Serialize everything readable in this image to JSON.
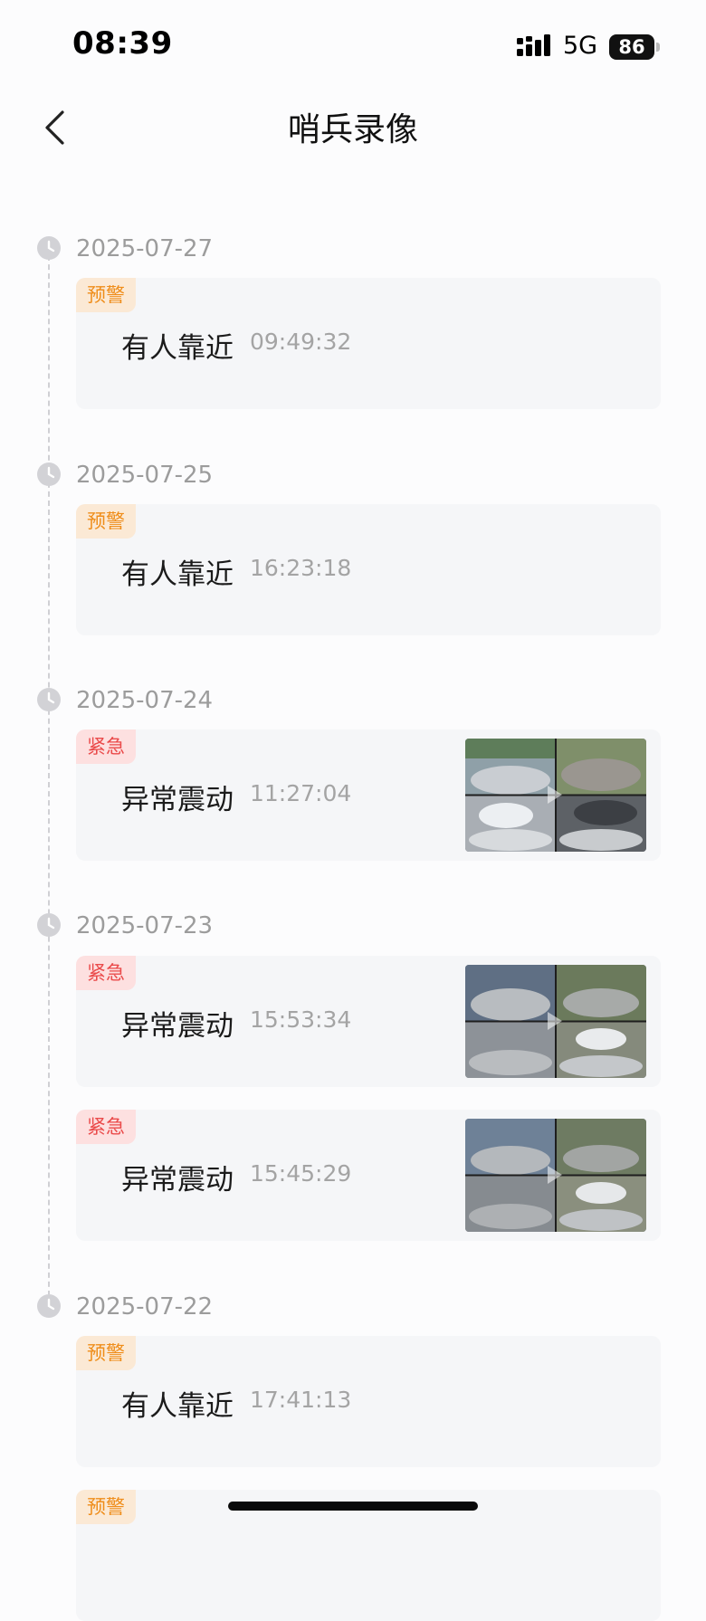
{
  "status_bar": {
    "time": "08:39",
    "network": "5G",
    "battery": "86"
  },
  "header": {
    "title": "哨兵录像",
    "back_icon": "chevron-left-icon"
  },
  "timeline": [
    {
      "date": "2025-07-27",
      "records": [
        {
          "badge": "预警",
          "badge_type": "warn",
          "event": "有人靠近",
          "time": "09:49:32",
          "has_thumbnail": false
        }
      ]
    },
    {
      "date": "2025-07-25",
      "records": [
        {
          "badge": "预警",
          "badge_type": "warn",
          "event": "有人靠近",
          "time": "16:23:18",
          "has_thumbnail": false
        }
      ]
    },
    {
      "date": "2025-07-24",
      "records": [
        {
          "badge": "紧急",
          "badge_type": "urgent",
          "event": "异常震动",
          "time": "11:27:04",
          "has_thumbnail": true
        }
      ]
    },
    {
      "date": "2025-07-23",
      "records": [
        {
          "badge": "紧急",
          "badge_type": "urgent",
          "event": "异常震动",
          "time": "15:53:34",
          "has_thumbnail": true
        },
        {
          "badge": "紧急",
          "badge_type": "urgent",
          "event": "异常震动",
          "time": "15:45:29",
          "has_thumbnail": true
        }
      ]
    },
    {
      "date": "2025-07-22",
      "records": [
        {
          "badge": "预警",
          "badge_type": "warn",
          "event": "有人靠近",
          "time": "17:41:13",
          "has_thumbnail": false
        },
        {
          "badge": "预警",
          "badge_type": "warn",
          "event": "",
          "time": "",
          "has_thumbnail": false
        }
      ]
    }
  ],
  "colors": {
    "warn_text": "#ef8d1a",
    "warn_bg": "#fbe9d5",
    "urgent_text": "#ea4a4a",
    "urgent_bg": "#fde0e0",
    "card_bg": "#f5f6f8",
    "muted_text": "#9c9c9c"
  }
}
